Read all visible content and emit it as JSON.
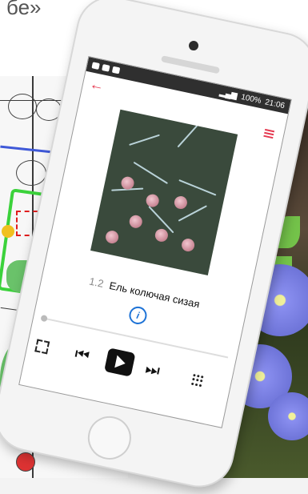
{
  "background": {
    "caption_fragment": "бе»"
  },
  "status_bar": {
    "battery_text": "100%",
    "time": "21:06"
  },
  "app": {
    "back_icon": "arrow-left-icon",
    "playlist_icon": "playlist-icon",
    "accent_color": "#e53950"
  },
  "track": {
    "number": "1.2",
    "title": "Ель колючая сизая",
    "info_icon": "info-icon"
  },
  "player": {
    "progress": 0.0,
    "controls": [
      "repeat-icon",
      "previous-icon",
      "play-icon",
      "next-icon",
      "keypad-icon"
    ]
  }
}
